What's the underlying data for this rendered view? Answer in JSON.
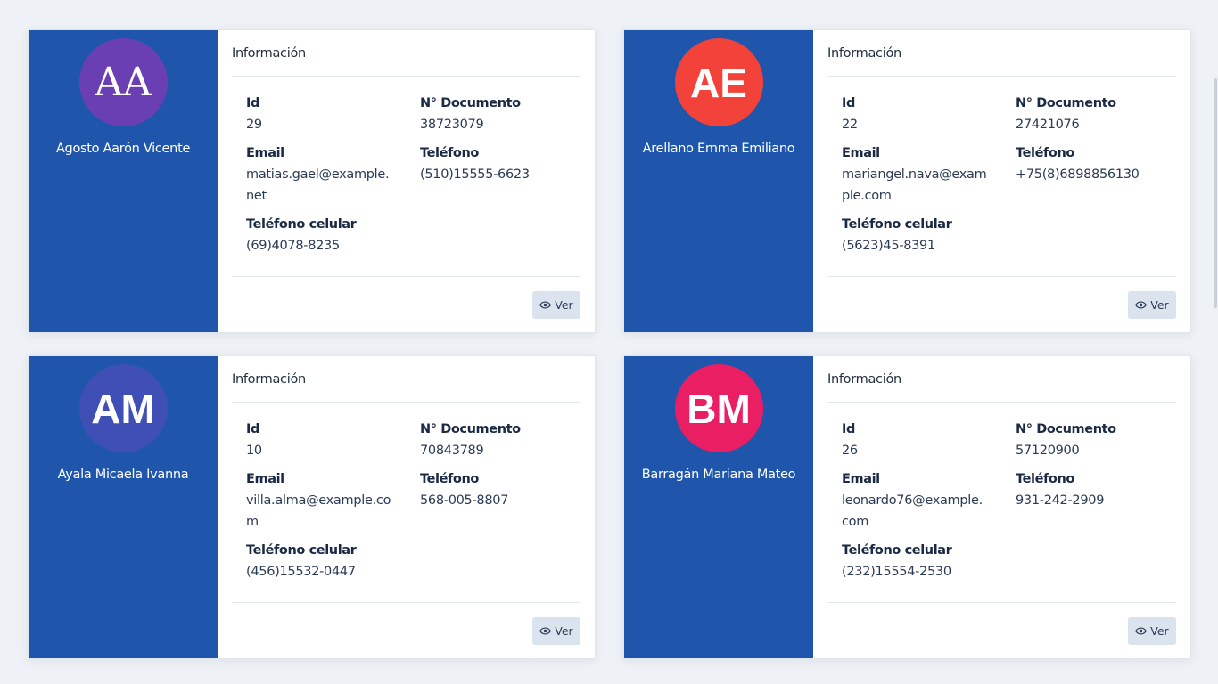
{
  "cards": [
    {
      "initials": "AA",
      "avatar_color": "#6b3fb4",
      "full_name": "Agosto Aarón Vicente",
      "section_title": "Información",
      "id_label": "Id",
      "id_value": "29",
      "doc_label": "N° Documento",
      "doc_value": "38723079",
      "email_label": "Email",
      "email_value": "matias.gael@example.net",
      "tel_label": "Teléfono",
      "tel_value": "(510)15555-6623",
      "cel_label": "Teléfono celular",
      "cel_value": "(69)4078-8235",
      "button_label": "Ver"
    },
    {
      "initials": "AE",
      "avatar_color": "#f2423a",
      "full_name": "Arellano Emma Emiliano",
      "section_title": "Información",
      "id_label": "Id",
      "id_value": "22",
      "doc_label": "N° Documento",
      "doc_value": "27421076",
      "email_label": "Email",
      "email_value": "mariangel.nava@example.com",
      "tel_label": "Teléfono",
      "tel_value": "+75(8)6898856130",
      "cel_label": "Teléfono celular",
      "cel_value": "(5623)45-8391",
      "button_label": "Ver"
    },
    {
      "initials": "AM",
      "avatar_color": "#3f4fb6",
      "full_name": "Ayala Micaela Ivanna",
      "section_title": "Información",
      "id_label": "Id",
      "id_value": "10",
      "doc_label": "N° Documento",
      "doc_value": "70843789",
      "email_label": "Email",
      "email_value": "villa.alma@example.com",
      "tel_label": "Teléfono",
      "tel_value": "568-005-8807",
      "cel_label": "Teléfono celular",
      "cel_value": "(456)15532-0447",
      "button_label": "Ver"
    },
    {
      "initials": "BM",
      "avatar_color": "#e91e63",
      "full_name": "Barragán Mariana Mateo",
      "section_title": "Información",
      "id_label": "Id",
      "id_value": "26",
      "doc_label": "N° Documento",
      "doc_value": "57120900",
      "email_label": "Email",
      "email_value": "leonardo76@example.com",
      "tel_label": "Teléfono",
      "tel_value": "931-242-2909",
      "cel_label": "Teléfono celular",
      "cel_value": "(232)15554-2530",
      "button_label": "Ver"
    }
  ],
  "colors": {
    "sidebar": "#1f56ac",
    "background": "#eef1f6",
    "button": "#dbe3ee"
  },
  "icons": {
    "view_button_icon": "eye-icon"
  }
}
